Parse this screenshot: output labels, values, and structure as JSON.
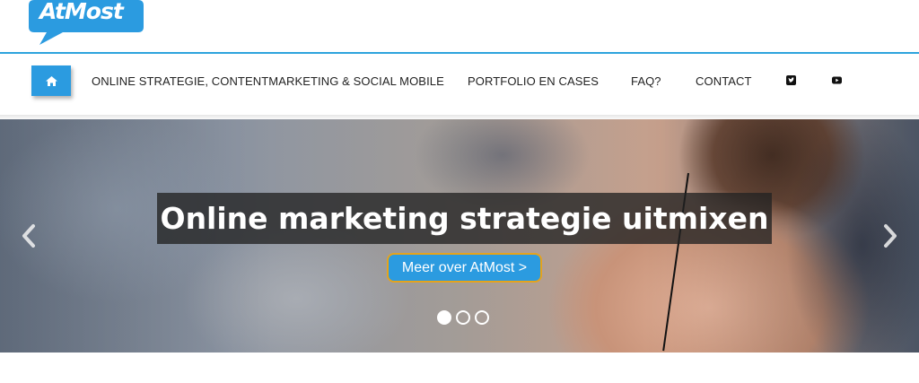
{
  "brand": {
    "logo_text": "AtMost",
    "logo_color": "#2b9be0"
  },
  "nav": {
    "home_icon": "home-icon",
    "items": [
      {
        "label": "ONLINE STRATEGIE, CONTENTMARKETING & SOCIAL MOBILE"
      },
      {
        "label": "PORTFOLIO EN CASES"
      },
      {
        "label": "FAQ?"
      },
      {
        "label": "CONTACT"
      }
    ],
    "social_icons": [
      "twitter-icon",
      "youtube-icon"
    ]
  },
  "hero": {
    "headline": "Online marketing strategie uitmixen",
    "cta_label": "Meer over AtMost >",
    "slides_total": 3,
    "active_slide": 1,
    "prev_icon": "chevron-left-icon",
    "next_icon": "chevron-right-icon"
  },
  "colors": {
    "accent": "#2b9be0",
    "cta_border": "#e5a31c",
    "nav_text": "#222222"
  }
}
